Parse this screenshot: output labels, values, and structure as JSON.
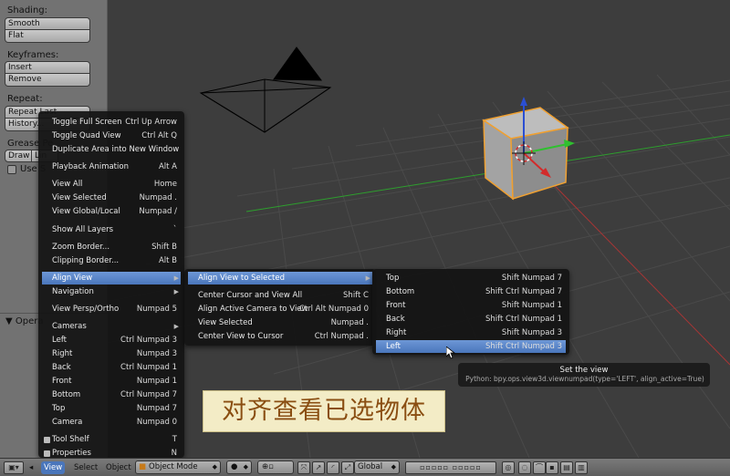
{
  "toolshelf": {
    "shading_label": "Shading:",
    "smooth": "Smooth",
    "flat": "Flat",
    "keyframes_label": "Keyframes:",
    "insert": "Insert",
    "remove": "Remove",
    "repeat_label": "Repeat:",
    "repeat_last": "Repeat Last",
    "history": "History...",
    "grease_label": "Grease Pe",
    "draw": "Draw",
    "line": "Lin",
    "use_sketching": "Use S"
  },
  "operator_panel": {
    "title": "Opera"
  },
  "view_menu": {
    "items": [
      {
        "label": "Toggle Full Screen",
        "shortcut": "Ctrl Up Arrow"
      },
      {
        "label": "Toggle Quad View",
        "shortcut": "Ctrl Alt Q"
      },
      {
        "label": "Duplicate Area into New Window",
        "shortcut": ""
      },
      {
        "label": "Playback Animation",
        "shortcut": "Alt A"
      },
      {
        "label": "View All",
        "shortcut": "Home"
      },
      {
        "label": "View Selected",
        "shortcut": "Numpad ."
      },
      {
        "label": "View Global/Local",
        "shortcut": "Numpad /"
      },
      {
        "label": "Show All Layers",
        "shortcut": "`"
      },
      {
        "label": "Zoom Border...",
        "shortcut": "Shift B"
      },
      {
        "label": "Clipping Border...",
        "shortcut": "Alt B"
      },
      {
        "label": "Align View",
        "shortcut": ""
      },
      {
        "label": "Navigation",
        "shortcut": ""
      },
      {
        "label": "View Persp/Ortho",
        "shortcut": "Numpad 5"
      },
      {
        "label": "Cameras",
        "shortcut": ""
      },
      {
        "label": "Left",
        "shortcut": "Ctrl Numpad 3"
      },
      {
        "label": "Right",
        "shortcut": "Numpad 3"
      },
      {
        "label": "Back",
        "shortcut": "Ctrl Numpad 1"
      },
      {
        "label": "Front",
        "shortcut": "Numpad 1"
      },
      {
        "label": "Bottom",
        "shortcut": "Ctrl Numpad 7"
      },
      {
        "label": "Top",
        "shortcut": "Numpad 7"
      },
      {
        "label": "Camera",
        "shortcut": "Numpad 0"
      },
      {
        "label": "Tool Shelf",
        "shortcut": "T"
      },
      {
        "label": "Properties",
        "shortcut": "N"
      }
    ]
  },
  "align_menu": {
    "items": [
      {
        "label": "Align View to Selected",
        "shortcut": ""
      },
      {
        "label": "Center Cursor and View All",
        "shortcut": "Shift C"
      },
      {
        "label": "Align Active Camera to View",
        "shortcut": "Ctrl Alt Numpad 0"
      },
      {
        "label": "View Selected",
        "shortcut": "Numpad ."
      },
      {
        "label": "Center View to Cursor",
        "shortcut": "Ctrl Numpad ."
      }
    ]
  },
  "selected_menu": {
    "items": [
      {
        "label": "Top",
        "shortcut": "Shift Numpad 7"
      },
      {
        "label": "Bottom",
        "shortcut": "Shift Ctrl Numpad 7"
      },
      {
        "label": "Front",
        "shortcut": "Shift Numpad 1"
      },
      {
        "label": "Back",
        "shortcut": "Shift Ctrl Numpad 1"
      },
      {
        "label": "Right",
        "shortcut": "Shift Numpad 3"
      },
      {
        "label": "Left",
        "shortcut": "Shift Ctrl Numpad 3"
      }
    ]
  },
  "tooltip": {
    "title": "Set the view",
    "python": "Python: bpy.ops.view3d.viewnumpad(type='LEFT', align_active=True)"
  },
  "caption": "对齐查看已选物体",
  "header": {
    "view": "View",
    "select": "Select",
    "object": "Object",
    "mode": "Object Mode",
    "orientation": "Global"
  },
  "colors": {
    "highlight": "#5b86c8",
    "menu_bg": "#141414",
    "caption_text": "#8a4e12",
    "caption_bg": "#f3ecc6",
    "x_axis": "#d22b2b",
    "y_axis": "#2fc02f",
    "z_axis": "#2b4fd2",
    "selection_outline": "#f0a030"
  }
}
